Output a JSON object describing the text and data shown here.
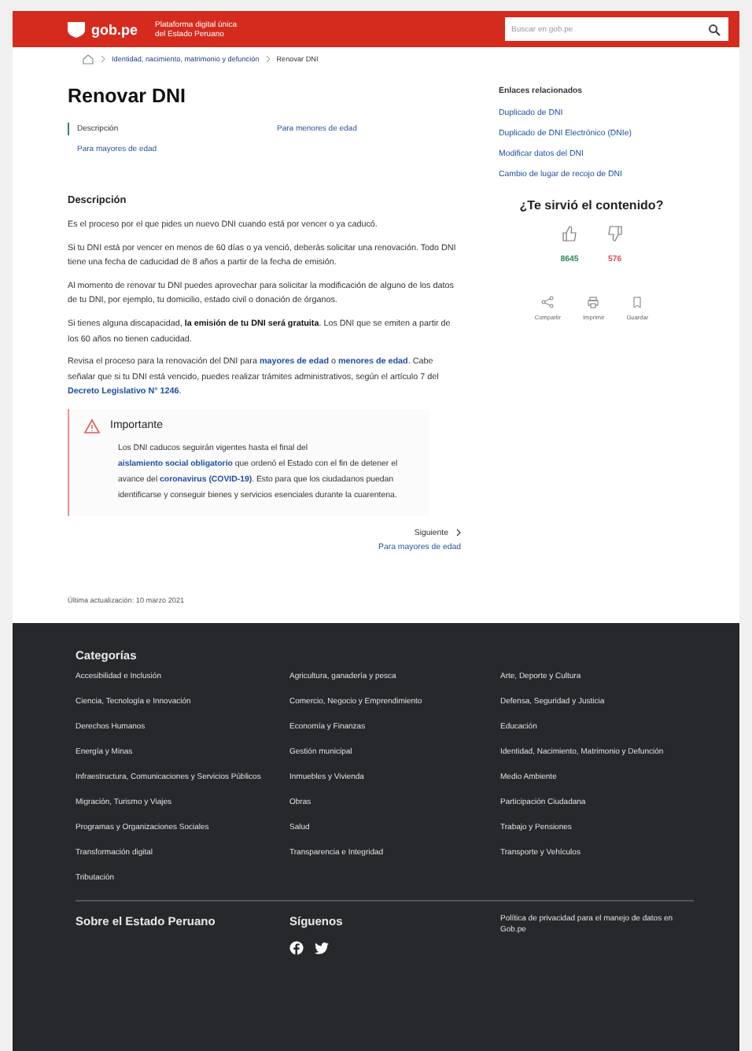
{
  "header": {
    "logo_text": "gob.pe",
    "tagline": "Plataforma digital única del Estado Peruano",
    "search_placeholder": "Buscar en gob.pe"
  },
  "breadcrumb": [
    "Identidad, nacimiento, matrimonio y defunción",
    "Renovar DNI"
  ],
  "title": "Renovar DNI",
  "sections": [
    {
      "label": "Descripción",
      "selected": true
    },
    {
      "label": "Para menores de edad",
      "selected": false
    },
    {
      "label": "Para mayores de edad",
      "selected": false
    }
  ],
  "description": {
    "heading": "Descripción",
    "paragraphs": [
      [
        {
          "kind": "text",
          "text": "Es el proceso por el que pides un nuevo DNI cuando está por vencer o ya caducó."
        }
      ],
      [
        {
          "kind": "text",
          "text": "Si tu DNI está por vencer en menos de 60 días o ya venció, deberás solicitar una renovación. Todo DNI tiene una fecha de caducidad de 8 años a partir de la fecha de emisión."
        }
      ],
      [
        {
          "kind": "text",
          "text": "Al momento de renovar tu DNI puedes aprovechar para solicitar la modificación de alguno de los datos de tu DNI, por ejemplo, tu domicilio, estado civil o donación de órganos."
        }
      ],
      [
        {
          "kind": "text",
          "text": "Si tienes alguna discapacidad, "
        },
        {
          "kind": "bold",
          "text": "la emisión de tu DNI será gratuita"
        },
        {
          "kind": "text",
          "text": ". Los DNI que se emiten a partir de los 60 años no tienen caducidad."
        }
      ],
      [
        {
          "kind": "text",
          "text": "Revisa el proceso para la renovación del DNI para "
        },
        {
          "kind": "link",
          "text": "mayores de edad"
        },
        {
          "kind": "text",
          "text": " o "
        },
        {
          "kind": "link",
          "text": "menores de edad"
        },
        {
          "kind": "text",
          "text": ". Cabe señalar que si tu DNI está vencido, puedes realizar trámites administrativos, según el artículo 7 del "
        },
        {
          "kind": "link",
          "text": "Decreto Legislativo N° 1246"
        },
        {
          "kind": "text",
          "text": "."
        }
      ]
    ]
  },
  "notice": {
    "title": "Importante",
    "segments": [
      {
        "kind": "text",
        "text": "Los DNI caducos seguirán vigentes hasta el final del "
      },
      {
        "kind": "link",
        "text": "aislamiento social "
      },
      {
        "kind": "link",
        "text": "obligatorio"
      },
      {
        "kind": "text",
        "text": " que ordenó el Estado con el fin de detener el avance del "
      },
      {
        "kind": "link",
        "text": "coronavirus "
      },
      {
        "kind": "link",
        "text": "(COVID-19)"
      },
      {
        "kind": "text",
        "text": ". Esto para que los ciudadanos puedan identificarse y conseguir bienes y servicios esenciales durante la cuarentena."
      }
    ]
  },
  "next": {
    "label": "Siguiente",
    "target": "Para mayores de edad"
  },
  "last_updated": "Última actualización: 10 marzo 2021",
  "related": {
    "title": "Enlaces relacionados",
    "links": [
      "Duplicado de DNI",
      "Duplicado de DNI Electrónico (DNIe)",
      "Modificar datos del DNI",
      "Cambio de lugar de recojo de DNI"
    ]
  },
  "feedback": {
    "question": "¿Te sirvió el contenido?",
    "up": "8645",
    "down": "576"
  },
  "actions": [
    {
      "kind": "share",
      "label": "Compartir"
    },
    {
      "kind": "print",
      "label": "Imprimir"
    },
    {
      "kind": "save",
      "label": "Guardar"
    }
  ],
  "footer": {
    "categories_title": "Categorías",
    "categories": [
      "Accesibilidad e Inclusión",
      "Agricultura, ganadería y pesca",
      "Arte, Deporte y Cultura",
      "Ciencia, Tecnología e Innovación",
      "Comercio, Negocio y Emprendimiento",
      "Defensa, Seguridad y Justicia",
      "Derechos Humanos",
      "Economía y Finanzas",
      "Educación",
      "Energía y Minas",
      "Gestión municipal",
      "Identidad, Nacimiento, Matrimonio y Defunción",
      "Infraestructura, Comunicaciones y Servicios Públicos",
      "Inmuebles y Vivienda",
      "Medio Ambiente",
      "Migración, Turismo y Viajes",
      "Obras",
      "Participación Ciudadana",
      "Programas y Organizaciones Sociales",
      "Salud",
      "Trabajo y Pensiones",
      "Transformación digital",
      "Transparencia e Integridad",
      "Transporte y Vehículos",
      "Tributación"
    ],
    "about": "Sobre el Estado Peruano",
    "follow": {
      "title": "Síguenos",
      "networks": [
        {
          "kind": "facebook"
        },
        {
          "kind": "twitter"
        }
      ]
    },
    "privacy": "Política de privacidad para el manejo de datos en Gob.pe"
  }
}
